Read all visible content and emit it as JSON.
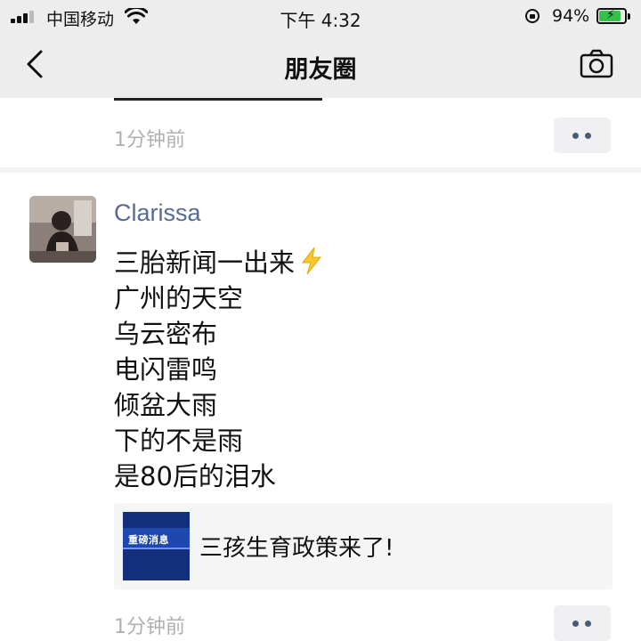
{
  "status_bar": {
    "carrier": "中国移动",
    "time": "下午 4:32",
    "battery_percent": "94%",
    "battery_level": 0.94,
    "icons": [
      "signal-icon",
      "wifi-icon",
      "rotation-lock-icon",
      "battery-charging-icon"
    ]
  },
  "nav": {
    "title": "朋友圈",
    "back_icon": "chevron-left-icon",
    "camera_icon": "camera-icon"
  },
  "prev_post": {
    "time_ago": "1分钟前",
    "more_icon": "more-dots-icon"
  },
  "post": {
    "author": "Clarissa",
    "lines": [
      "三胎新闻一出来",
      "广州的天空",
      "乌云密布",
      "电闪雷鸣",
      "倾盆大雨",
      "下的不是雨",
      "是80后的泪水"
    ],
    "emoji": "lightning-emoji",
    "link": {
      "thumb_label": "重磅消息",
      "title": "三孩生育政策来了!"
    },
    "time_ago": "1分钟前"
  },
  "colors": {
    "bar_bg": "#ededed",
    "author": "#576b95",
    "muted": "#b0b0b0",
    "battery_fill": "#36c24a",
    "thumb_bg": "#15307e"
  }
}
